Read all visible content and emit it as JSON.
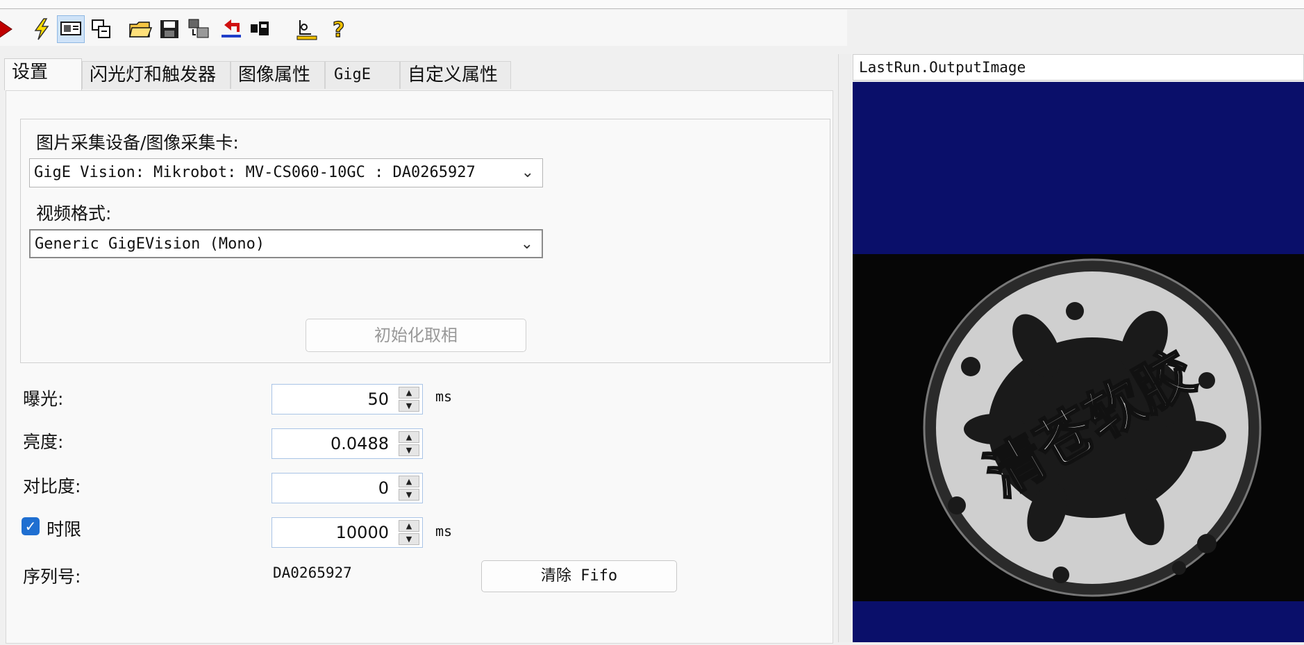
{
  "tabs": [
    {
      "label": "设置",
      "selected": true
    },
    {
      "label": "闪光灯和触发器",
      "selected": false
    },
    {
      "label": "图像属性",
      "selected": false
    },
    {
      "label": "GigE",
      "selected": false
    },
    {
      "label": "自定义属性",
      "selected": false
    }
  ],
  "settings": {
    "device_label": "图片采集设备/图像采集卡:",
    "device_value": "GigE Vision: Mikrobot: MV-CS060-10GC : DA0265927",
    "format_label": "视频格式:",
    "format_value": "Generic GigEVision (Mono)",
    "init_button": "初始化取相",
    "exposure_label": "曝光:",
    "exposure_value": "50",
    "exposure_unit": "ms",
    "brightness_label": "亮度:",
    "brightness_value": "0.0488",
    "contrast_label": "对比度:",
    "contrast_value": "0",
    "timeout_label": "时限",
    "timeout_checked": true,
    "timeout_value": "10000",
    "timeout_unit": "ms",
    "serial_label": "序列号:",
    "serial_value": "DA0265927",
    "clear_fifo_button": "清除 Fifo"
  },
  "image_panel": {
    "title": "LastRun.OutputImage",
    "background_color": "#0a0f6a",
    "logo_text": "清苍软胶"
  },
  "toolbar_icons": [
    "run-icon",
    "lightning-icon",
    "monitor-icon",
    "copy-window-icon",
    "open-folder-icon",
    "save-icon",
    "export-icon",
    "reset-icon",
    "camera-icon",
    "settings-tool-icon",
    "help-icon"
  ]
}
